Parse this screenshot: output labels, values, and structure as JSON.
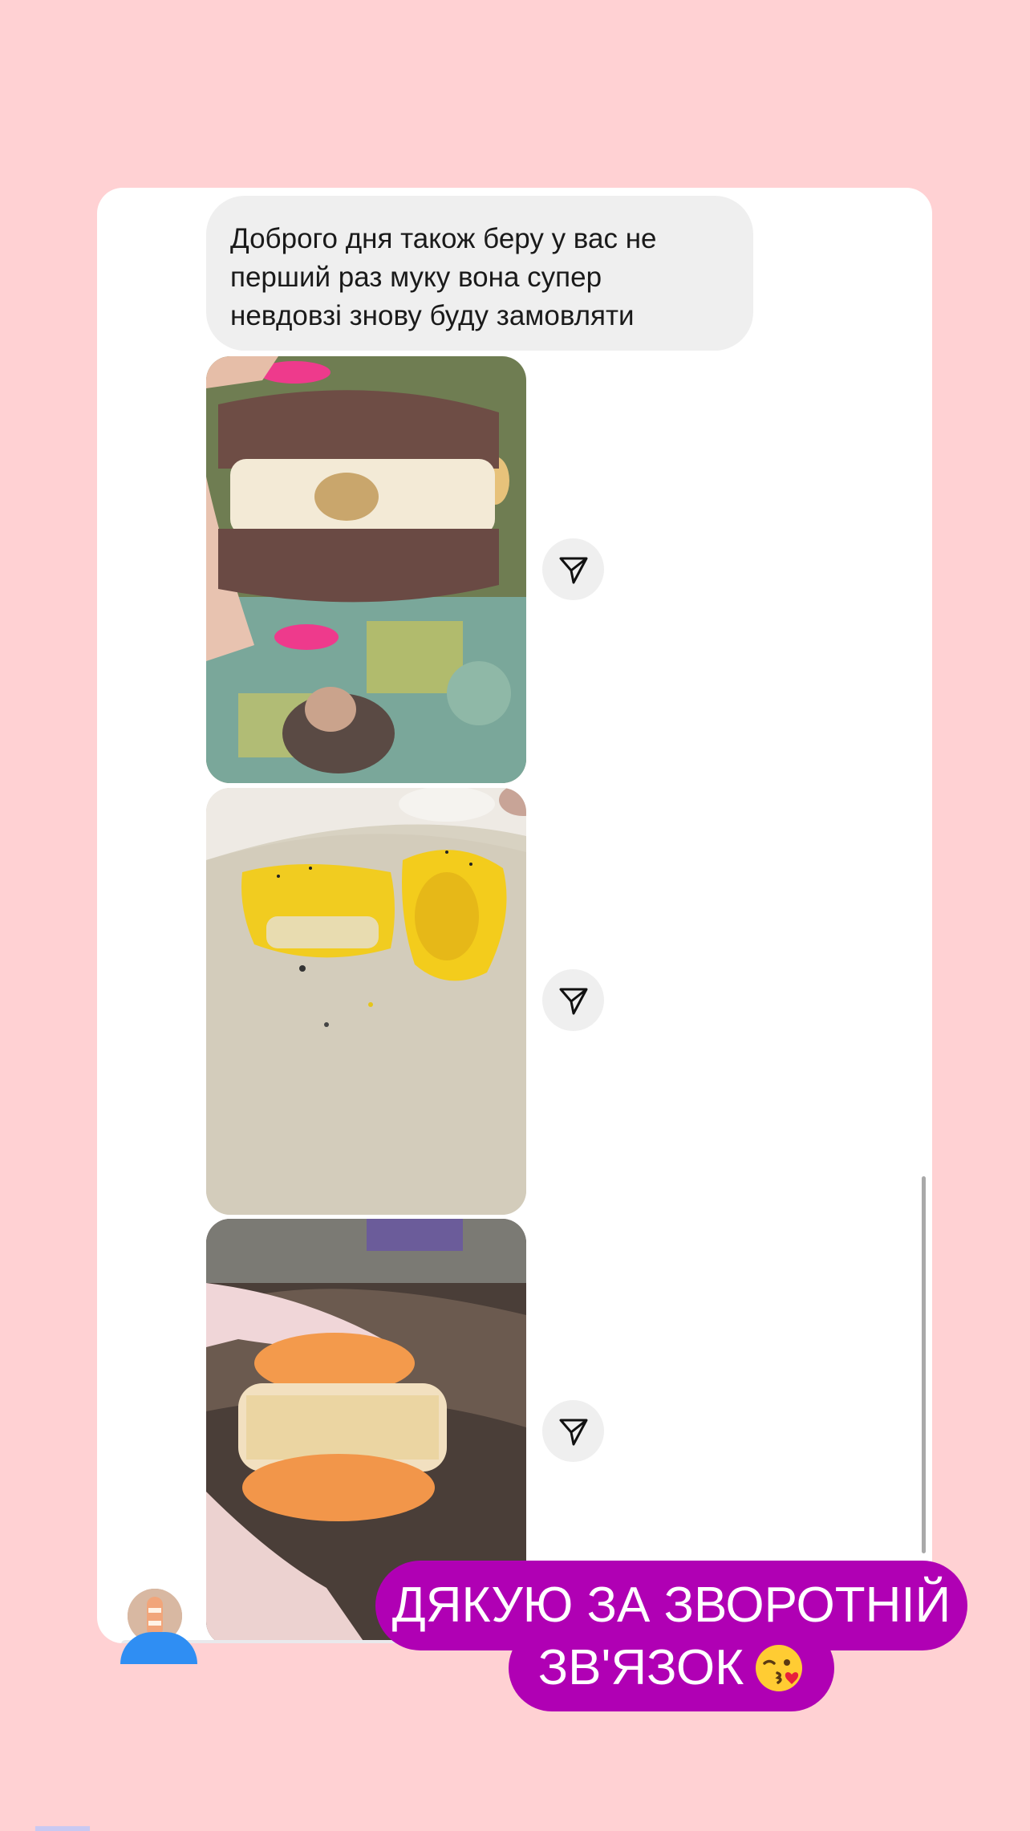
{
  "chat": {
    "message_text": "Доброго дня також беру у вас не перший раз муку вона супер невдовзі знову буду замовляти",
    "message_lines": [
      "Доброго дня також беру у вас не",
      "перший раз муку вона супер",
      "невдовзі знову буду замовляти"
    ],
    "photos": [
      {
        "subject": "chocolate macaron with cream filling held in hand"
      },
      {
        "subject": "yellow macaron cut in half on a plate"
      },
      {
        "subject": "orange macaron with crunchy filling held in hand"
      }
    ],
    "share_icon": "paper-plane-icon"
  },
  "sticker": {
    "line1": "ДЯКУЮ ЗА ЗВОРОТНІЙ",
    "line2": "ЗВ'ЯЗОК",
    "emoji": "kissing-face-with-heart-icon"
  },
  "colors": {
    "background": "#ffd1d3",
    "bubble": "#efefef",
    "sticker": "#b000b4"
  }
}
